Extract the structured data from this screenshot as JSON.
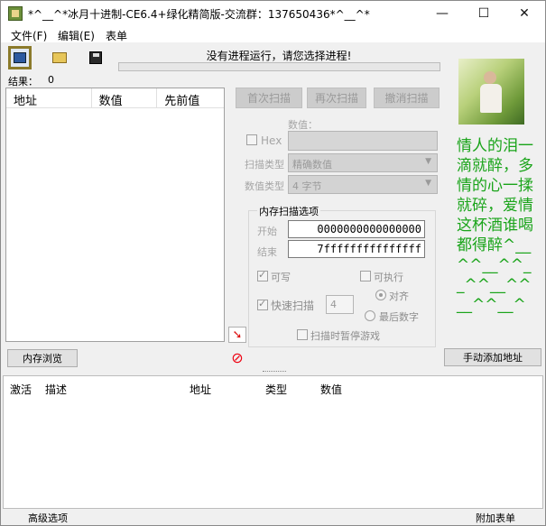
{
  "window": {
    "title": "*^__^*冰月十进制-CE6.4+绿化精简版-交流群：137650436*^__^*",
    "minimize_glyph": "—",
    "maximize_glyph": "☐",
    "close_glyph": "✕"
  },
  "menu": [
    "文件(F)",
    "编辑(E)",
    "表单"
  ],
  "toolbar": {
    "icons": [
      "select-process-icon",
      "open-file-icon",
      "save-icon"
    ]
  },
  "process_status": "没有进程运行，请您选择进程!",
  "progress_fraction": 0,
  "results": {
    "label": "结果：",
    "count": "0"
  },
  "result_list": {
    "columns": [
      "地址",
      "数值",
      "先前值"
    ]
  },
  "scan_buttons": {
    "first": "首次扫描",
    "next": "再次扫描",
    "undo": "撤消扫描"
  },
  "value": {
    "label": "数值：",
    "hex_label": "Hex",
    "scan_type_label": "扫描类型",
    "scan_type_value": "精确数值",
    "value_type_label": "数值类型",
    "value_type_value": "4 字节"
  },
  "memory_options": {
    "title": "内存扫描选项",
    "start_label": "开始",
    "start_value": "0000000000000000",
    "end_label": "结束",
    "end_value": "7fffffffffffffff",
    "writable": "可写",
    "executable": "可执行",
    "fast_scan": "快速扫描",
    "fast_scan_value": "4",
    "align": "对齐",
    "last_digit": "最后数字",
    "pause_game": "扫描时暂停游戏"
  },
  "poem": "情人的泪一滴就醉，多情的心一揉就碎，爱情这杯酒谁喝都得醉^__^^__^^__^^__^^__^^__^",
  "buttons": {
    "memory_browse": "内存浏览",
    "add_address": "手动添加地址"
  },
  "address_list": {
    "columns": [
      "激活",
      "描述",
      "地址",
      "类型",
      "数值"
    ]
  },
  "status_bar": {
    "advanced": "高级选项",
    "attach_table": "附加表单"
  },
  "colors": {
    "poem": "#1aa41a",
    "progress": "#06b025",
    "stop_icon": "#e01"
  }
}
